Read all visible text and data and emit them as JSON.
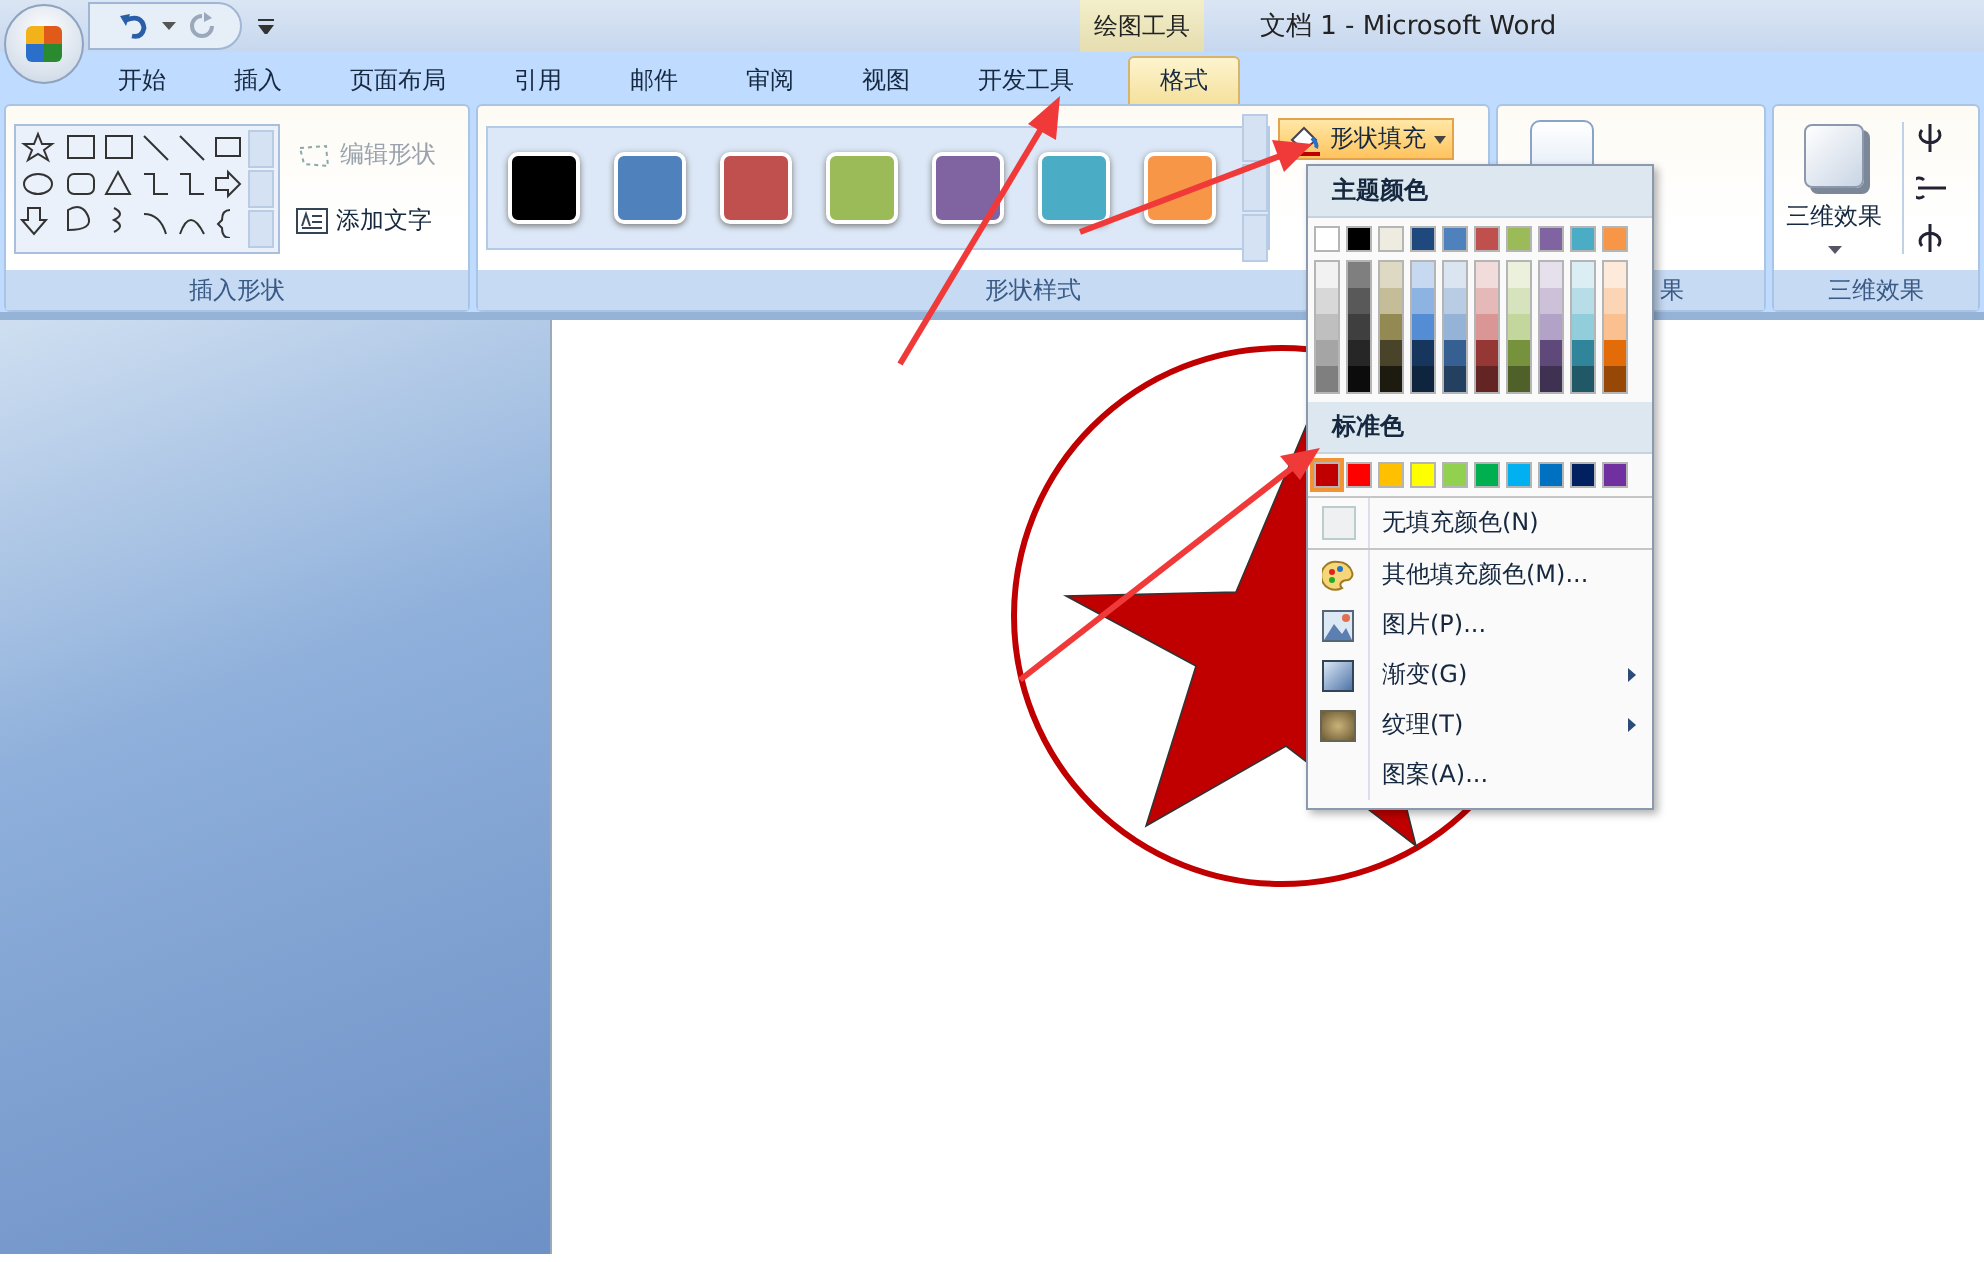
{
  "title_bar": {
    "contextual_tab": "绘图工具",
    "title": "文档 1 - Microsoft Word"
  },
  "tabs": [
    {
      "label": "开始",
      "selected": false
    },
    {
      "label": "插入",
      "selected": false
    },
    {
      "label": "页面布局",
      "selected": false
    },
    {
      "label": "引用",
      "selected": false
    },
    {
      "label": "邮件",
      "selected": false
    },
    {
      "label": "审阅",
      "selected": false
    },
    {
      "label": "视图",
      "selected": false
    },
    {
      "label": "开发工具",
      "selected": false
    },
    {
      "label": "格式",
      "selected": true
    }
  ],
  "insert_shapes": {
    "label": "插入形状",
    "edit_shape": {
      "label": "编辑形状",
      "disabled": true
    },
    "add_text": {
      "label": "添加文字",
      "disabled": false
    }
  },
  "shape_styles": {
    "label": "形状样式",
    "swatches": [
      {
        "color": "#000000"
      },
      {
        "color": "#4f81bd"
      },
      {
        "color": "#c0504d"
      },
      {
        "color": "#9bbb59"
      },
      {
        "color": "#8064a2"
      },
      {
        "color": "#4bacc6"
      },
      {
        "color": "#f79646"
      }
    ],
    "shape_fill": "形状填充"
  },
  "shadow_group": {
    "label": "果"
  },
  "three_d": {
    "button": "三维效果",
    "label": "三维效果"
  },
  "fill_menu": {
    "theme_header": "主题颜色",
    "theme_colors": [
      {
        "color": "#ffffff",
        "shades": [
          {
            "color": "#f2f2f2"
          },
          {
            "color": "#d8d8d8"
          },
          {
            "color": "#bfbfbf"
          },
          {
            "color": "#a5a5a5"
          },
          {
            "color": "#7f7f7f"
          }
        ]
      },
      {
        "color": "#000000",
        "shades": [
          {
            "color": "#7f7f7f"
          },
          {
            "color": "#595959"
          },
          {
            "color": "#3f3f3f"
          },
          {
            "color": "#262626"
          },
          {
            "color": "#0c0c0c"
          }
        ]
      },
      {
        "color": "#eeece1",
        "shades": [
          {
            "color": "#ddd9c3"
          },
          {
            "color": "#c4bd97"
          },
          {
            "color": "#938953"
          },
          {
            "color": "#494429"
          },
          {
            "color": "#1d1b10"
          }
        ]
      },
      {
        "color": "#1f497d",
        "shades": [
          {
            "color": "#c6d9f0"
          },
          {
            "color": "#8db3e2"
          },
          {
            "color": "#548dd4"
          },
          {
            "color": "#17365d"
          },
          {
            "color": "#0f243e"
          }
        ]
      },
      {
        "color": "#4f81bd",
        "shades": [
          {
            "color": "#dbe5f1"
          },
          {
            "color": "#b8cce4"
          },
          {
            "color": "#95b3d7"
          },
          {
            "color": "#366092"
          },
          {
            "color": "#244061"
          }
        ]
      },
      {
        "color": "#c0504d",
        "shades": [
          {
            "color": "#f2dcdb"
          },
          {
            "color": "#e5b9b7"
          },
          {
            "color": "#d99694"
          },
          {
            "color": "#953734"
          },
          {
            "color": "#632423"
          }
        ]
      },
      {
        "color": "#9bbb59",
        "shades": [
          {
            "color": "#ebf1dd"
          },
          {
            "color": "#d7e3bc"
          },
          {
            "color": "#c3d69b"
          },
          {
            "color": "#76923c"
          },
          {
            "color": "#4f6128"
          }
        ]
      },
      {
        "color": "#8064a2",
        "shades": [
          {
            "color": "#e5e0ec"
          },
          {
            "color": "#ccc1d9"
          },
          {
            "color": "#b2a2c7"
          },
          {
            "color": "#5f497a"
          },
          {
            "color": "#3f3151"
          }
        ]
      },
      {
        "color": "#4bacc6",
        "shades": [
          {
            "color": "#dbeef3"
          },
          {
            "color": "#b7dde8"
          },
          {
            "color": "#92cddc"
          },
          {
            "color": "#31859b"
          },
          {
            "color": "#205867"
          }
        ]
      },
      {
        "color": "#f79646",
        "shades": [
          {
            "color": "#fdeada"
          },
          {
            "color": "#fbd5b5"
          },
          {
            "color": "#fac08f"
          },
          {
            "color": "#e36c09"
          },
          {
            "color": "#974806"
          }
        ]
      }
    ],
    "standard_header": "标准色",
    "standard_colors": [
      {
        "color": "#c00000",
        "selected": true
      },
      {
        "color": "#ff0000",
        "selected": false
      },
      {
        "color": "#ffc000",
        "selected": false
      },
      {
        "color": "#ffff00",
        "selected": false
      },
      {
        "color": "#92d050",
        "selected": false
      },
      {
        "color": "#00b050",
        "selected": false
      },
      {
        "color": "#00b0f0",
        "selected": false
      },
      {
        "color": "#0070c0",
        "selected": false
      },
      {
        "color": "#002060",
        "selected": false
      },
      {
        "color": "#7030a0",
        "selected": false
      }
    ],
    "items": [
      {
        "kind": "none",
        "label": "无填充颜色(N)",
        "submenu": false
      },
      {
        "kind": "palette",
        "label": "其他填充颜色(M)...",
        "submenu": false
      },
      {
        "kind": "picture",
        "label": "图片(P)...",
        "submenu": false
      },
      {
        "kind": "gradient",
        "label": "渐变(G)",
        "submenu": true
      },
      {
        "kind": "texture",
        "label": "纹理(T)",
        "submenu": true
      },
      {
        "kind": "pattern",
        "label": "图案(A)...",
        "submenu": false
      }
    ]
  }
}
